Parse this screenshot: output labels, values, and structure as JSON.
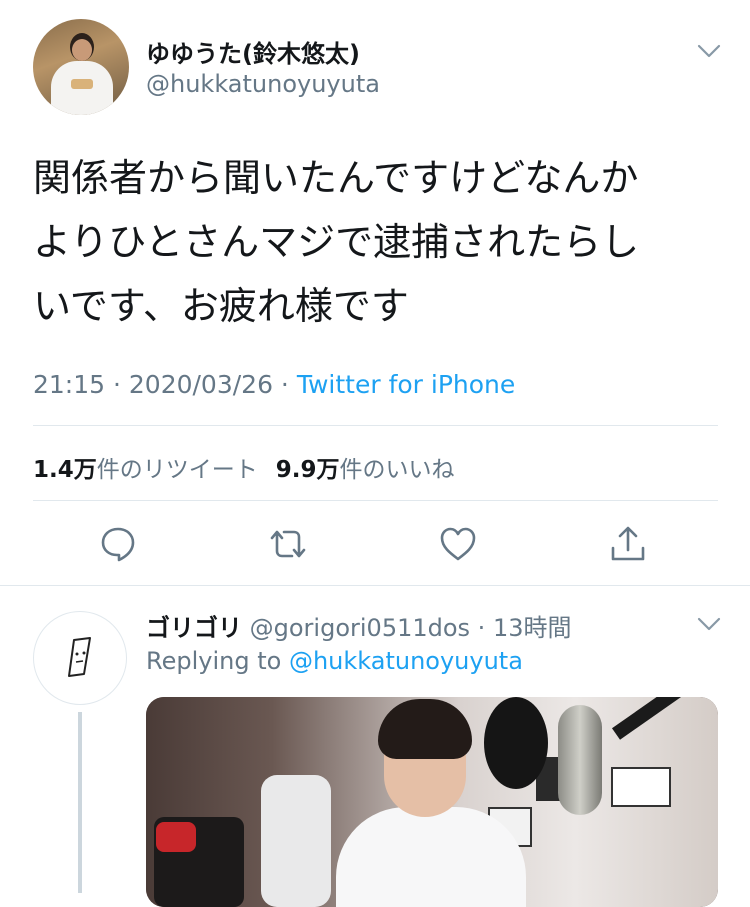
{
  "tweet": {
    "display_name": "ゆゆうた(鈴木悠太)",
    "handle": "@hukkatunoyuyuta",
    "text_lines": [
      "関係者から聞いたんですけどなんか",
      "よりひとさんマジで逮捕されたらし",
      "いです、お疲れ様です"
    ],
    "time": "21:15",
    "separator": " · ",
    "date": "2020/03/26",
    "source": "Twitter for iPhone",
    "retweet_count": "1.4万",
    "retweet_label": "件のリツイート",
    "like_count": "9.9万",
    "like_label": "件のいいね"
  },
  "actions": {
    "reply_icon": "reply-icon",
    "retweet_icon": "retweet-icon",
    "like_icon": "heart-icon",
    "share_icon": "share-icon"
  },
  "reply": {
    "display_name": "ゴリゴリ",
    "handle": "@gorigori0511dos",
    "separator": " · ",
    "time_ago": "13時間",
    "replying_prefix": "Replying to ",
    "replying_to": "@hukkatunoyuyuta"
  },
  "colors": {
    "accent": "#1da1f2",
    "secondary_text": "#657786",
    "primary_text": "#14171a",
    "divider": "#e1e8ed"
  }
}
